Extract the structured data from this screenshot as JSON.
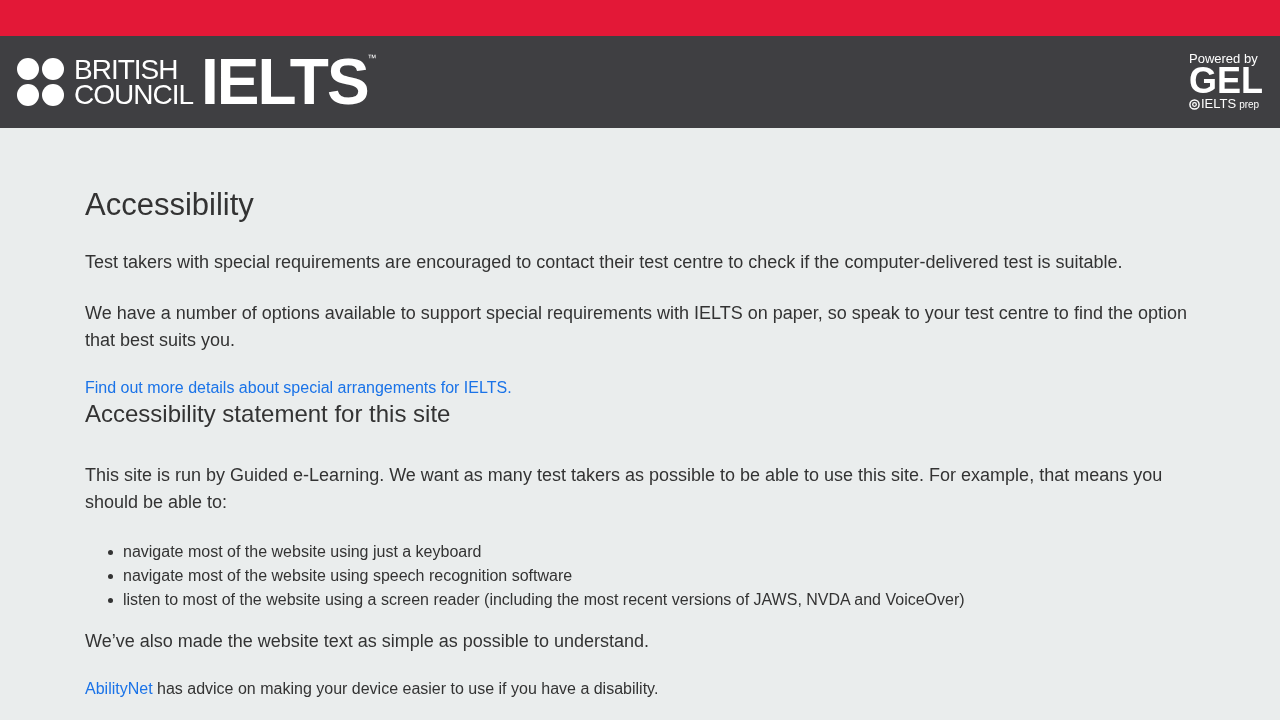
{
  "header": {
    "logo_top": "BRITISH",
    "logo_bottom": "COUNCIL",
    "product": "IELTS",
    "trademark": "™",
    "powered_by": "Powered by",
    "partner": "GEL",
    "partner_product": "IELTS",
    "partner_suffix": "prep"
  },
  "title": "Accessibility",
  "paragraphs": [
    "Test takers with special requirements are encouraged to contact their test centre to check if the computer-delivered test is suitable.",
    "We have a number of options available to support special requirements with IELTS on paper, so speak to your test centre to find the option that best suits you."
  ],
  "details_link": "Find out more details about special arrangements for IELTS.",
  "statement_heading": "Accessibility statement for this site",
  "statement_intro": "This site is run by Guided e-Learning. We want as many test takers as possible to be able to use this site. For example, that means you should be able to:",
  "abilities": [
    "navigate most of the website using just a keyboard",
    "navigate most of the website using speech recognition software",
    "listen to most of the website using a screen reader (including the most recent versions of JAWS, NVDA and VoiceOver)"
  ],
  "simple_text": "We’ve also made the website text as simple as possible to understand.",
  "advice": {
    "link": "AbilityNet",
    "text": " has advice on making your device easier to use if you have a disability."
  }
}
